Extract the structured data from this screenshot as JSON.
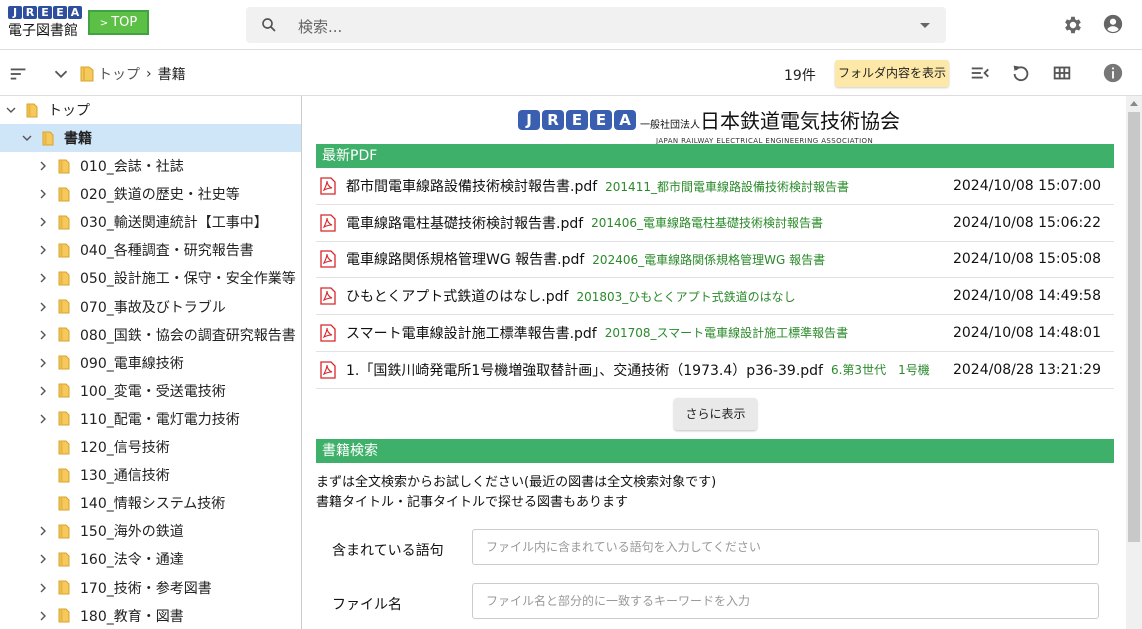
{
  "header": {
    "logo_letters": [
      "J",
      "R",
      "E",
      "E",
      "A"
    ],
    "logo_subtitle": "電子図書館",
    "top_button_label": "TOP",
    "search_placeholder": "検索...",
    "colors": {
      "top_button": "#5cbf46",
      "logo_blue": "#2d4f9e"
    }
  },
  "toolbar": {
    "breadcrumb_root": "トップ",
    "breadcrumb_current": "書籍",
    "count": "19件",
    "folder_button": "フォルダ内容を表示",
    "folder_button_color": "#fde8a7"
  },
  "sidebar": {
    "root_label": "トップ",
    "selected_label": "書籍",
    "items": [
      {
        "label": "010_会誌・社誌",
        "expandable": true
      },
      {
        "label": "020_鉄道の歴史・社史等",
        "expandable": true
      },
      {
        "label": "030_輸送関連統計【工事中】",
        "expandable": true
      },
      {
        "label": "040_各種調査・研究報告書",
        "expandable": true
      },
      {
        "label": "050_設計施工・保守・安全作業等",
        "expandable": true
      },
      {
        "label": "070_事故及びトラブル",
        "expandable": true
      },
      {
        "label": "080_国鉄・協会の調査研究報告書",
        "expandable": true
      },
      {
        "label": "090_電車線技術",
        "expandable": true
      },
      {
        "label": "100_変電・受送電技術",
        "expandable": true
      },
      {
        "label": "110_配電・電灯電力技術",
        "expandable": true
      },
      {
        "label": "120_信号技術",
        "expandable": false
      },
      {
        "label": "130_通信技術",
        "expandable": false
      },
      {
        "label": "140_情報システム技術",
        "expandable": false
      },
      {
        "label": "150_海外の鉄道",
        "expandable": true
      },
      {
        "label": "160_法令・通達",
        "expandable": true
      },
      {
        "label": "170_技術・参考図書",
        "expandable": true
      },
      {
        "label": "180_教育・図書",
        "expandable": true
      }
    ]
  },
  "main": {
    "brand_letters": [
      "J",
      "R",
      "E",
      "E",
      "A"
    ],
    "brand_prefix": "一般社団法人",
    "brand_name": "日本鉄道電気技術協会",
    "brand_en": "JAPAN RAILWAY ELECTRICAL ENGINEERING ASSOCIATION",
    "latest_title": "最新PDF",
    "pdfs": [
      {
        "name": "都市間電車線路設備技術検討報告書.pdf",
        "folder": "201411_都市間電車線路設備技術検討報告書",
        "date": "2024/10/08 15:07:00"
      },
      {
        "name": "電車線路電柱基礎技術検討報告書.pdf",
        "folder": "201406_電車線路電柱基礎技術検討報告書",
        "date": "2024/10/08 15:06:22"
      },
      {
        "name": "電車線路関係規格管理WG 報告書.pdf",
        "folder": "202406_電車線路関係規格管理WG 報告書",
        "date": "2024/10/08 15:05:08"
      },
      {
        "name": "ひもとくアプト式鉄道のはなし.pdf",
        "folder": "201803_ひもとくアプト式鉄道のはなし",
        "date": "2024/10/08 14:49:58"
      },
      {
        "name": "スマート電車線設計施工標準報告書.pdf",
        "folder": "201708_スマート電車線設計施工標準報告書",
        "date": "2024/10/08 14:48:01"
      },
      {
        "name": "1.「国鉄川崎発電所1号機増強取替計画」、交通技術（1973.4）p36-39.pdf",
        "folder": "6.第3世代　1号機",
        "date": "2024/08/28 13:21:29"
      }
    ],
    "more_button": "さらに表示",
    "search_title": "書籍検索",
    "desc_line1": "まずは全文検索からお試しください(最近の図書は全文検索対象です)",
    "desc_line2": "書籍タイトル・記事タイトルで探せる図書もあります",
    "field1_label": "含まれている語句",
    "field1_placeholder": "ファイル内に含まれている語句を入力してください",
    "field2_label": "ファイル名",
    "field2_placeholder": "ファイル名と部分的に一致するキーワードを入力",
    "colors": {
      "section_bar": "#3fb06a",
      "folder_text": "#2a8a2a",
      "pdf_icon": "#d9262b"
    }
  }
}
